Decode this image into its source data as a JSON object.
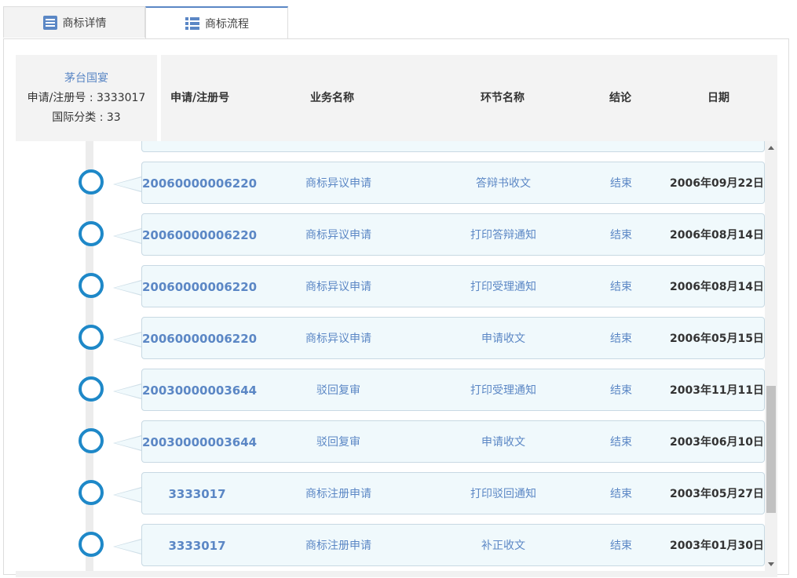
{
  "tabs": {
    "detail_label": "商标详情",
    "flow_label": "商标流程"
  },
  "info": {
    "brand_name": "茅台国宴",
    "reg_line": "申请/注册号 : 3333017",
    "class_line": "国际分类 : 33"
  },
  "columns": {
    "reg_no": "申请/注册号",
    "business": "业务名称",
    "step": "环节名称",
    "result": "结论",
    "date": "日期"
  },
  "rows": [
    {
      "reg_no": "20060000006220",
      "business": "商标异议申请",
      "step": "答辩书收文",
      "result": "结束",
      "date": "2006年09月22日"
    },
    {
      "reg_no": "20060000006220",
      "business": "商标异议申请",
      "step": "打印答辩通知",
      "result": "结束",
      "date": "2006年08月14日"
    },
    {
      "reg_no": "20060000006220",
      "business": "商标异议申请",
      "step": "打印受理通知",
      "result": "结束",
      "date": "2006年08月14日"
    },
    {
      "reg_no": "20060000006220",
      "business": "商标异议申请",
      "step": "申请收文",
      "result": "结束",
      "date": "2006年05月15日"
    },
    {
      "reg_no": "20030000003644",
      "business": "驳回复审",
      "step": "打印受理通知",
      "result": "结束",
      "date": "2003年11月11日"
    },
    {
      "reg_no": "20030000003644",
      "business": "驳回复审",
      "step": "申请收文",
      "result": "结束",
      "date": "2003年06月10日"
    },
    {
      "reg_no": "3333017",
      "business": "商标注册申请",
      "step": "打印驳回通知",
      "result": "结束",
      "date": "2003年05月27日"
    },
    {
      "reg_no": "3333017",
      "business": "商标注册申请",
      "step": "补正收文",
      "result": "结束",
      "date": "2003年01月30日"
    }
  ],
  "colors": {
    "accent": "#5b87c5",
    "timeline": "#1e88c8",
    "card_bg": "#f0f9fc"
  }
}
